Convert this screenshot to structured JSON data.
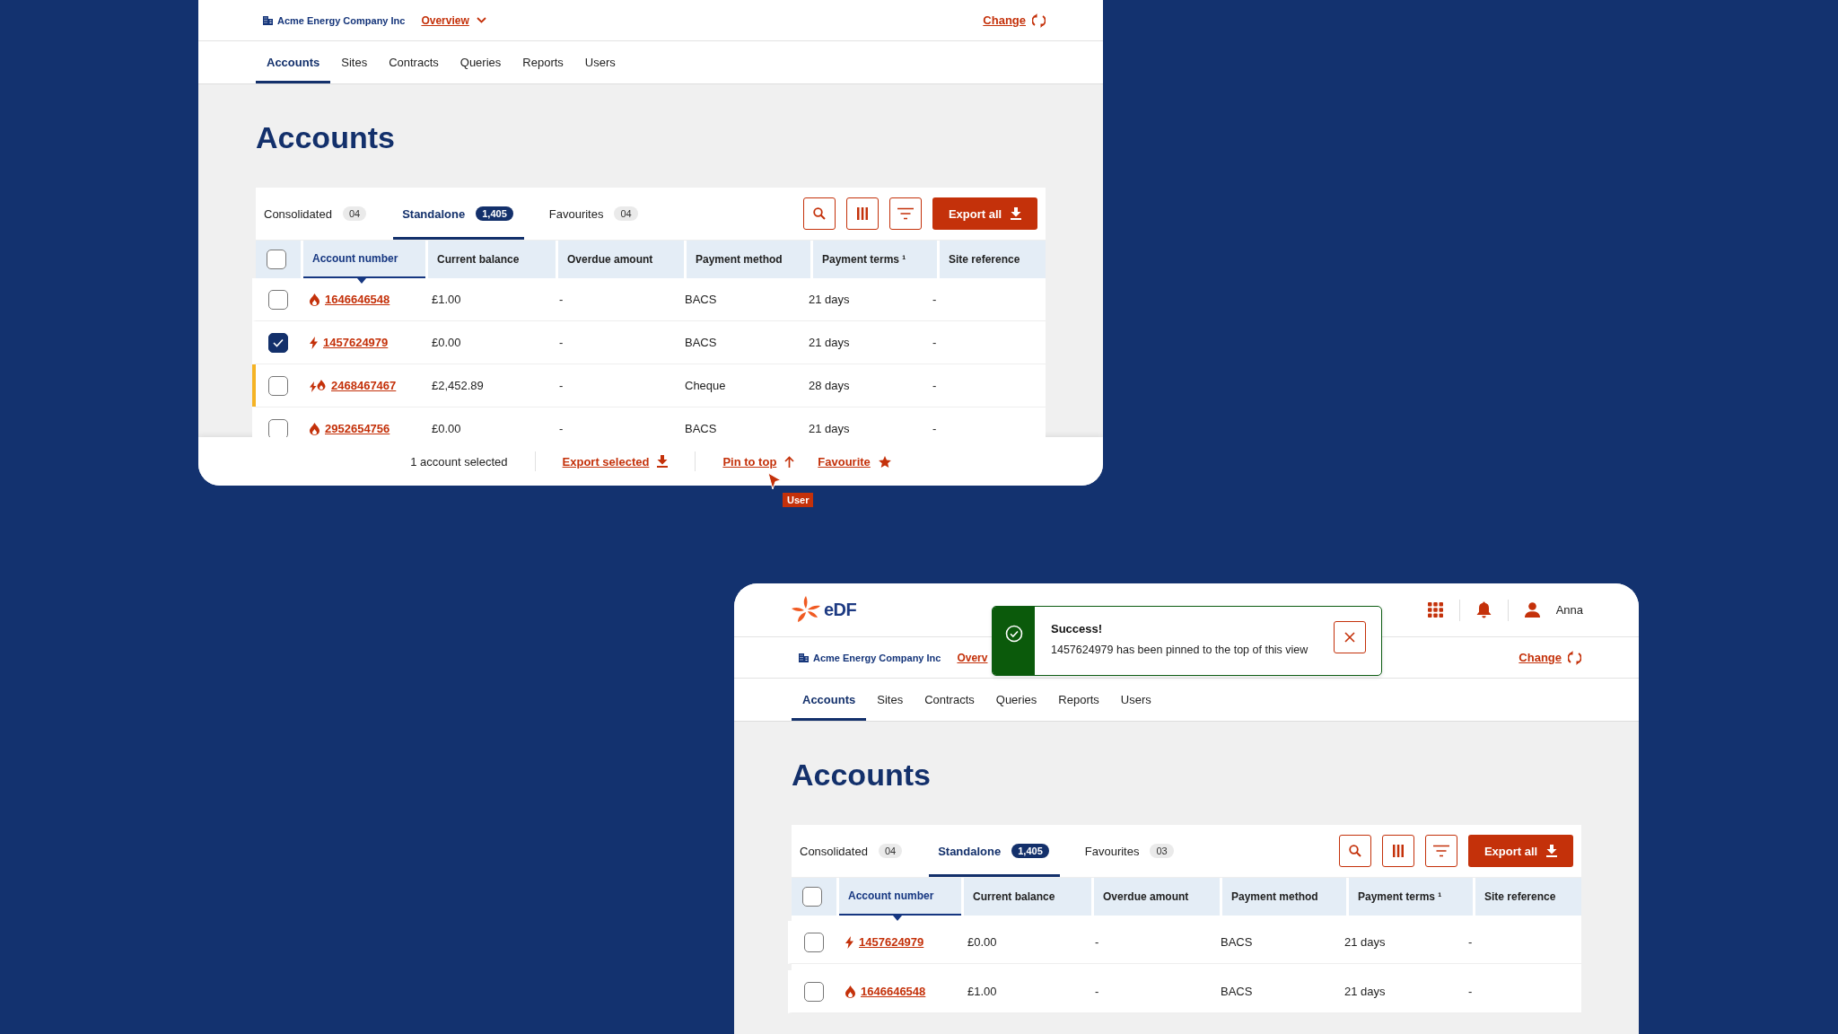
{
  "screens": [
    {
      "company": "Acme Energy Company Inc",
      "view_menu": {
        "label": "Overview",
        "chevron": true
      },
      "change_link": "Change",
      "nav": [
        {
          "label": "Accounts",
          "selected": true
        },
        {
          "label": "Sites",
          "selected": false
        },
        {
          "label": "Contracts",
          "selected": false
        },
        {
          "label": "Queries",
          "selected": false
        },
        {
          "label": "Reports",
          "selected": false
        },
        {
          "label": "Users",
          "selected": false
        }
      ],
      "title": "Accounts",
      "tabs": [
        {
          "label": "Consolidated",
          "count": "04",
          "selected": false
        },
        {
          "label": "Standalone",
          "count": "1,405",
          "selected": true
        },
        {
          "label": "Favourites",
          "count": "04",
          "selected": false
        }
      ],
      "export_button": "Export all",
      "select_all": {
        "checked": false
      },
      "columns": [
        {
          "label": "Account number",
          "sorted": true
        },
        {
          "label": "Current balance",
          "sorted": false
        },
        {
          "label": "Overdue amount",
          "sorted": false
        },
        {
          "label": "Payment method",
          "sorted": false
        },
        {
          "label": "Payment terms ¹",
          "sorted": false
        },
        {
          "label": "Site reference",
          "sorted": false
        }
      ],
      "rows": [
        {
          "kind": "gas",
          "account": "1646646548",
          "balance": "£1.00",
          "overdue": "-",
          "method": "BACS",
          "terms": "21 days",
          "site": "-",
          "checked": false,
          "highlighted": false,
          "pinned": false
        },
        {
          "kind": "electric",
          "account": "1457624979",
          "balance": "£0.00",
          "overdue": "-",
          "method": "BACS",
          "terms": "21 days",
          "site": "-",
          "checked": true,
          "highlighted": false,
          "pinned": false
        },
        {
          "kind": "dual",
          "account": "2468467467",
          "balance": "£2,452.89",
          "overdue": "-",
          "method": "Cheque",
          "terms": "28 days",
          "site": "-",
          "checked": false,
          "highlighted": true,
          "pinned": false
        },
        {
          "kind": "gas",
          "account": "2952654756",
          "balance": "£0.00",
          "overdue": "-",
          "method": "BACS",
          "terms": "21 days",
          "site": "-",
          "checked": false,
          "highlighted": false,
          "pinned": false
        }
      ],
      "action_bar": {
        "selection": "1 account selected",
        "actions": [
          {
            "label": "Export selected"
          },
          {
            "label": "Pin to top"
          },
          {
            "label": "Favourite"
          }
        ]
      },
      "cursor": {
        "label": "User"
      }
    },
    {
      "brand": "eDF",
      "user": "Anna",
      "company": "Acme Energy Company Inc",
      "view_menu": {
        "label": "Overv",
        "chevron": false
      },
      "change_link": "Change",
      "toast": {
        "title": "Success!",
        "message": "1457624979 has been pinned to the top of this view"
      },
      "nav": [
        {
          "label": "Accounts",
          "selected": true
        },
        {
          "label": "Sites",
          "selected": false
        },
        {
          "label": "Contracts",
          "selected": false
        },
        {
          "label": "Queries",
          "selected": false
        },
        {
          "label": "Reports",
          "selected": false
        },
        {
          "label": "Users",
          "selected": false
        }
      ],
      "title": "Accounts",
      "tabs": [
        {
          "label": "Consolidated",
          "count": "04",
          "selected": false
        },
        {
          "label": "Standalone",
          "count": "1,405",
          "selected": true
        },
        {
          "label": "Favourites",
          "count": "03",
          "selected": false
        }
      ],
      "export_button": "Export all",
      "select_all": {
        "checked": false
      },
      "columns": [
        {
          "label": "Account number",
          "sorted": true
        },
        {
          "label": "Current balance",
          "sorted": false
        },
        {
          "label": "Overdue amount",
          "sorted": false
        },
        {
          "label": "Payment method",
          "sorted": false
        },
        {
          "label": "Payment terms ¹",
          "sorted": false
        },
        {
          "label": "Site reference",
          "sorted": false
        }
      ],
      "rows": [
        {
          "kind": "electric",
          "account": "1457624979",
          "balance": "£0.00",
          "overdue": "-",
          "method": "BACS",
          "terms": "21 days",
          "site": "-",
          "checked": false,
          "highlighted": false,
          "pinned": true
        },
        {
          "kind": "gas",
          "account": "1646646548",
          "balance": "£1.00",
          "overdue": "-",
          "method": "BACS",
          "terms": "21 days",
          "site": "-",
          "checked": false,
          "highlighted": false,
          "pinned": false
        }
      ]
    }
  ]
}
